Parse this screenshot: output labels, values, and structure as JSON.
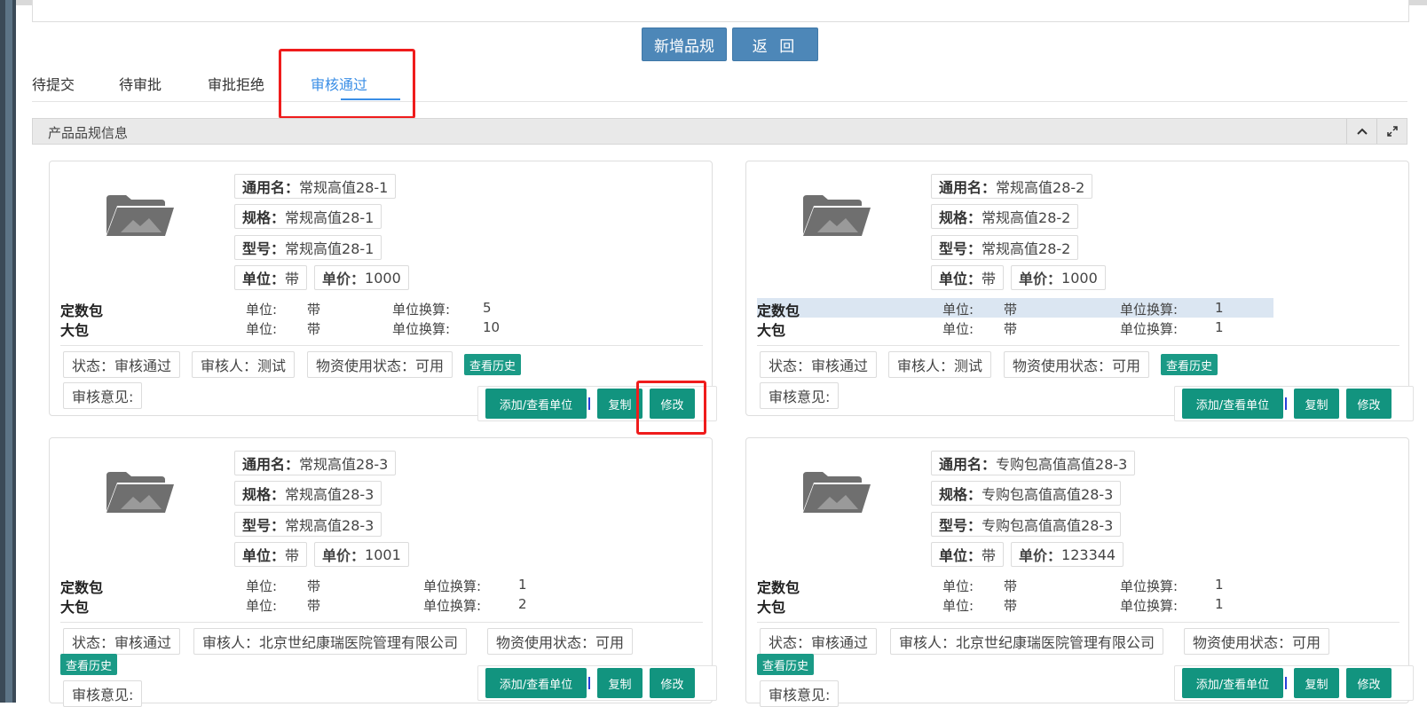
{
  "toolbar": {
    "new_label": "新增品规",
    "back_label": "返 回"
  },
  "tabs": [
    {
      "label": "待提交"
    },
    {
      "label": "待审批"
    },
    {
      "label": "审批拒绝"
    },
    {
      "label": "审核通过",
      "active": true
    }
  ],
  "panel": {
    "title": "产品品规信息"
  },
  "labels": {
    "generic": "通用名",
    "spec": "规格",
    "model": "型号",
    "unit": "单位",
    "price": "单价",
    "colon": "：",
    "unit_pkg": "单位:",
    "conversion": "单位换算:",
    "history_btn": "查看历史",
    "add_unit_btn": "添加/查看单位",
    "copy_btn": "复制",
    "edit_btn": "修改",
    "opinion": "审核意见:"
  },
  "cards": [
    {
      "generic": "常规高值28-1",
      "spec": "常规高值28-1",
      "model": "常规高值28-1",
      "unit": "带",
      "price": "1000",
      "packages": [
        {
          "name": "定数包",
          "unit": "带",
          "conversion": "5"
        },
        {
          "name": "大包",
          "unit": "带",
          "conversion": "10"
        }
      ],
      "status": "状态：审核通过",
      "reviewer": "审核人：测试",
      "usage": "物资使用状态：可用"
    },
    {
      "generic": "常规高值28-2",
      "spec": "常规高值28-2",
      "model": "常规高值28-2",
      "unit": "带",
      "price": "1000",
      "packages": [
        {
          "name": "定数包",
          "unit": "带",
          "conversion": "1"
        },
        {
          "name": "大包",
          "unit": "带",
          "conversion": "1"
        }
      ],
      "status": "状态：审核通过",
      "reviewer": "审核人：测试",
      "usage": "物资使用状态：可用"
    },
    {
      "generic": "常规高值28-3",
      "spec": "常规高值28-3",
      "model": "常规高值28-3",
      "unit": "带",
      "price": "1001",
      "packages": [
        {
          "name": "定数包",
          "unit": "带",
          "conversion": "1"
        },
        {
          "name": "大包",
          "unit": "带",
          "conversion": "2"
        }
      ],
      "status": "状态：审核通过",
      "reviewer": "审核人：北京世纪康瑞医院管理有限公司",
      "usage": "物资使用状态：可用"
    },
    {
      "generic": "专购包高值高值28-3",
      "spec": "专购包高值高值28-3",
      "model": "专购包高值高值28-3",
      "unit": "带",
      "price": "123344",
      "packages": [
        {
          "name": "定数包",
          "unit": "带",
          "conversion": "1"
        },
        {
          "name": "大包",
          "unit": "带",
          "conversion": "1"
        }
      ],
      "status": "状态：审核通过",
      "reviewer": "审核人：北京世纪康瑞医院管理有限公司",
      "usage": "物资使用状态：可用"
    }
  ],
  "colors": {
    "accent": "#3a8ee6",
    "teal": "#12947f",
    "primary": "#4d87b8",
    "annotation": "#ef1c1c"
  },
  "icons": {
    "folder": "folder-image-icon",
    "collapse": "chevron-up-icon",
    "expand": "expand-icon"
  }
}
